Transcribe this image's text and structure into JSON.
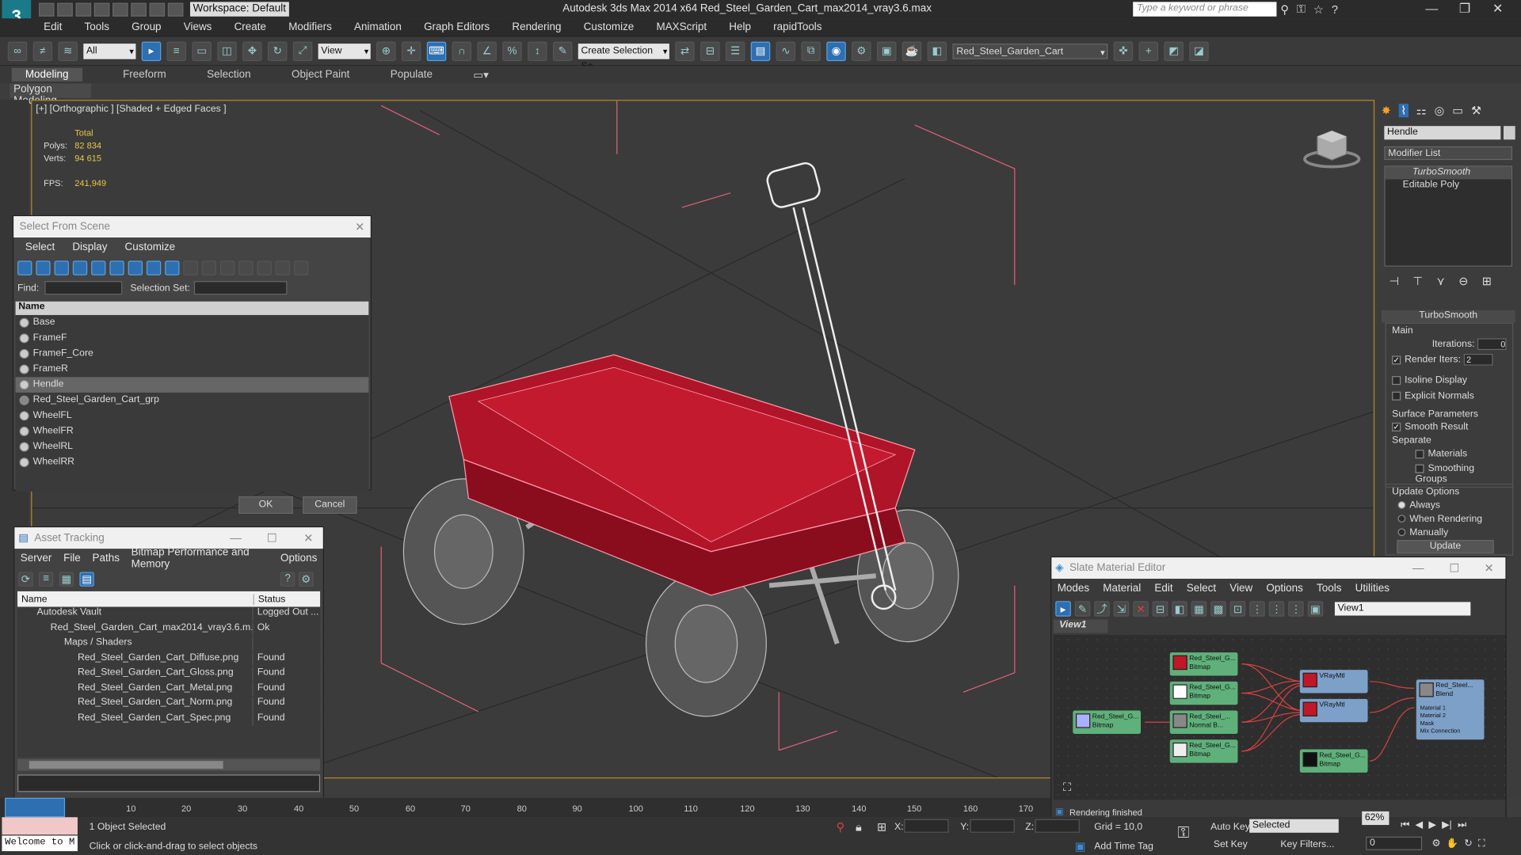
{
  "app": {
    "title": "Autodesk 3ds Max  2014 x64     Red_Steel_Garden_Cart_max2014_vray3.6.max",
    "workspace": "Workspace: Default",
    "search_placeholder": "Type a keyword or phrase"
  },
  "menu": [
    "Edit",
    "Tools",
    "Group",
    "Views",
    "Create",
    "Modifiers",
    "Animation",
    "Graph Editors",
    "Rendering",
    "Customize",
    "MAXScript",
    "Help",
    "rapidTools"
  ],
  "toolbar": {
    "selection_filter": "All",
    "ref_coord": "View",
    "named_selection": "Create Selection Se",
    "object_name": "Red_Steel_Garden_Cart"
  },
  "ribbon": {
    "tabs": [
      "Modeling",
      "Freeform",
      "Selection",
      "Object Paint",
      "Populate"
    ],
    "active_tab": "Modeling",
    "panel": "Polygon Modeling"
  },
  "viewport": {
    "label": "[+] [Orthographic ] [Shaded + Edged Faces ]",
    "stats": {
      "total_label": "Total",
      "polys_label": "Polys:",
      "polys": "82 834",
      "verts_label": "Verts:",
      "verts": "94 615",
      "fps_label": "FPS:",
      "fps": "241,949"
    }
  },
  "select_dialog": {
    "title": "Select From Scene",
    "menu": [
      "Select",
      "Display",
      "Customize"
    ],
    "find_label": "Find:",
    "selset_label": "Selection Set:",
    "col_name": "Name",
    "items": [
      "Base",
      "FrameF",
      "FrameF_Core",
      "FrameR",
      "Hendle",
      "Red_Steel_Garden_Cart_grp",
      "WheelFL",
      "WheelFR",
      "WheelRL",
      "WheelRR"
    ],
    "selected": "Hendle",
    "ok": "OK",
    "cancel": "Cancel"
  },
  "asset_tracking": {
    "title": "Asset Tracking",
    "menu": [
      "Server",
      "File",
      "Paths",
      "Bitmap Performance and Memory",
      "Options"
    ],
    "col_name": "Name",
    "col_status": "Status",
    "rows": [
      {
        "name": "Autodesk Vault",
        "status": "Logged Out ..."
      },
      {
        "name": "Red_Steel_Garden_Cart_max2014_vray3.6.m...",
        "status": "Ok"
      },
      {
        "name": "Maps / Shaders",
        "status": ""
      },
      {
        "name": "Red_Steel_Garden_Cart_Diffuse.png",
        "status": "Found"
      },
      {
        "name": "Red_Steel_Garden_Cart_Gloss.png",
        "status": "Found"
      },
      {
        "name": "Red_Steel_Garden_Cart_Metal.png",
        "status": "Found"
      },
      {
        "name": "Red_Steel_Garden_Cart_Norm.png",
        "status": "Found"
      },
      {
        "name": "Red_Steel_Garden_Cart_Spec.png",
        "status": "Found"
      }
    ]
  },
  "command_panel": {
    "object_name": "Hendle",
    "modifier_list": "Modifier List",
    "stack": [
      "TurboSmooth",
      "Editable Poly"
    ],
    "rollout": "TurboSmooth",
    "main": "Main",
    "iterations_label": "Iterations:",
    "iterations": "0",
    "render_iters_label": "Render Iters:",
    "render_iters": "2",
    "isoline": "Isoline Display",
    "explicit": "Explicit Normals",
    "surface": "Surface Parameters",
    "smooth": "Smooth Result",
    "separate": "Separate",
    "materials": "Materials",
    "smoothing": "Smoothing Groups",
    "update_options": "Update Options",
    "always": "Always",
    "when_rendering": "When Rendering",
    "manually": "Manually",
    "update": "Update"
  },
  "slate": {
    "title": "Slate Material Editor",
    "menu": [
      "Modes",
      "Material",
      "Edit",
      "Select",
      "View",
      "Options",
      "Tools",
      "Utilities"
    ],
    "view_field": "View1",
    "tab": "View1",
    "nodes": [
      {
        "name": "Red_Steel_G...",
        "type": "Bitmap"
      },
      {
        "name": "Red_Steel_G...",
        "type": "Bitmap"
      },
      {
        "name": "Red_Steel_G...",
        "type": "Bitmap"
      },
      {
        "name": "Red_Steel_...",
        "type": "Normal B..."
      },
      {
        "name": "Red_Steel_G...",
        "type": "Bitmap"
      },
      {
        "name": "Red_Steel_G...",
        "type": "Bitmap"
      },
      {
        "name": "VRayMtl",
        "type": ""
      },
      {
        "name": "VRayMtl",
        "type": ""
      },
      {
        "name": "Red_Steel...",
        "type": "Blend"
      }
    ],
    "blend_slots": [
      "Material 1",
      "Material 2",
      "Mask",
      "Mix Connection"
    ],
    "status": "Rendering finished",
    "zoom": "62%"
  },
  "timeline": {
    "ticks": [
      "10",
      "20",
      "30",
      "40",
      "50",
      "60",
      "70",
      "80",
      "90",
      "100",
      "110",
      "120",
      "130",
      "140",
      "150",
      "160",
      "170"
    ]
  },
  "status_bar": {
    "selected": "1 Object Selected",
    "prompt": "Click or click-and-drag to select objects",
    "welcome": "Welcome to M",
    "x_label": "X:",
    "y_label": "Y:",
    "z_label": "Z:",
    "grid": "Grid = 10,0",
    "add_time_tag": "Add Time Tag",
    "auto_key": "Auto Key",
    "set_key": "Set Key",
    "key_mode": "Selected",
    "key_filters": "Key Filters...",
    "frame": "0"
  }
}
